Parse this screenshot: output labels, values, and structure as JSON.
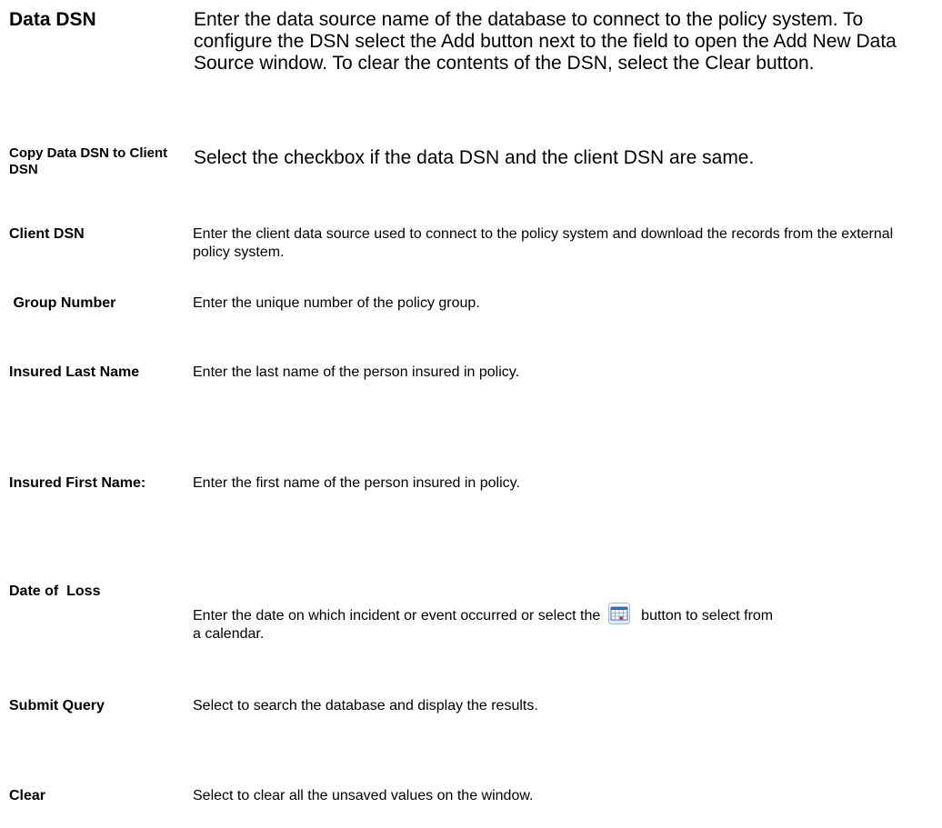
{
  "fields": [
    {
      "term": "Data DSN",
      "desc": "Enter the data source name of the database to connect to the policy system.  To configure the DSN select the Add button next to the field to open the Add New Data Source window.  To clear the contents of the DSN, select the Clear button."
    },
    {
      "term": "Copy Data DSN to Client DSN",
      "desc": "Select the checkbox if the data DSN and the client DSN are same."
    },
    {
      "term": "Client DSN",
      "desc": "Enter the client data source used to connect to the policy system and download the records from the external policy system."
    },
    {
      "term": " Group Number",
      "desc": "Enter the unique number of the policy group."
    },
    {
      "term": "Insured Last Name",
      "desc": "Enter the last name of  the person insured in policy."
    },
    {
      "term": "Insured First Name:",
      "desc": "Enter the first name of the person insured in policy."
    },
    {
      "term": "Date of  Loss",
      "desc_before": "Enter the date on which incident or event occurred or select the",
      "desc_after": "button to select from a calendar.",
      "icon": "calendar-icon"
    },
    {
      "term": "Submit Query",
      "desc": "Select to search the database and display the results."
    },
    {
      "term": "Clear",
      "desc": "Select to clear all the unsaved values on the window."
    }
  ]
}
